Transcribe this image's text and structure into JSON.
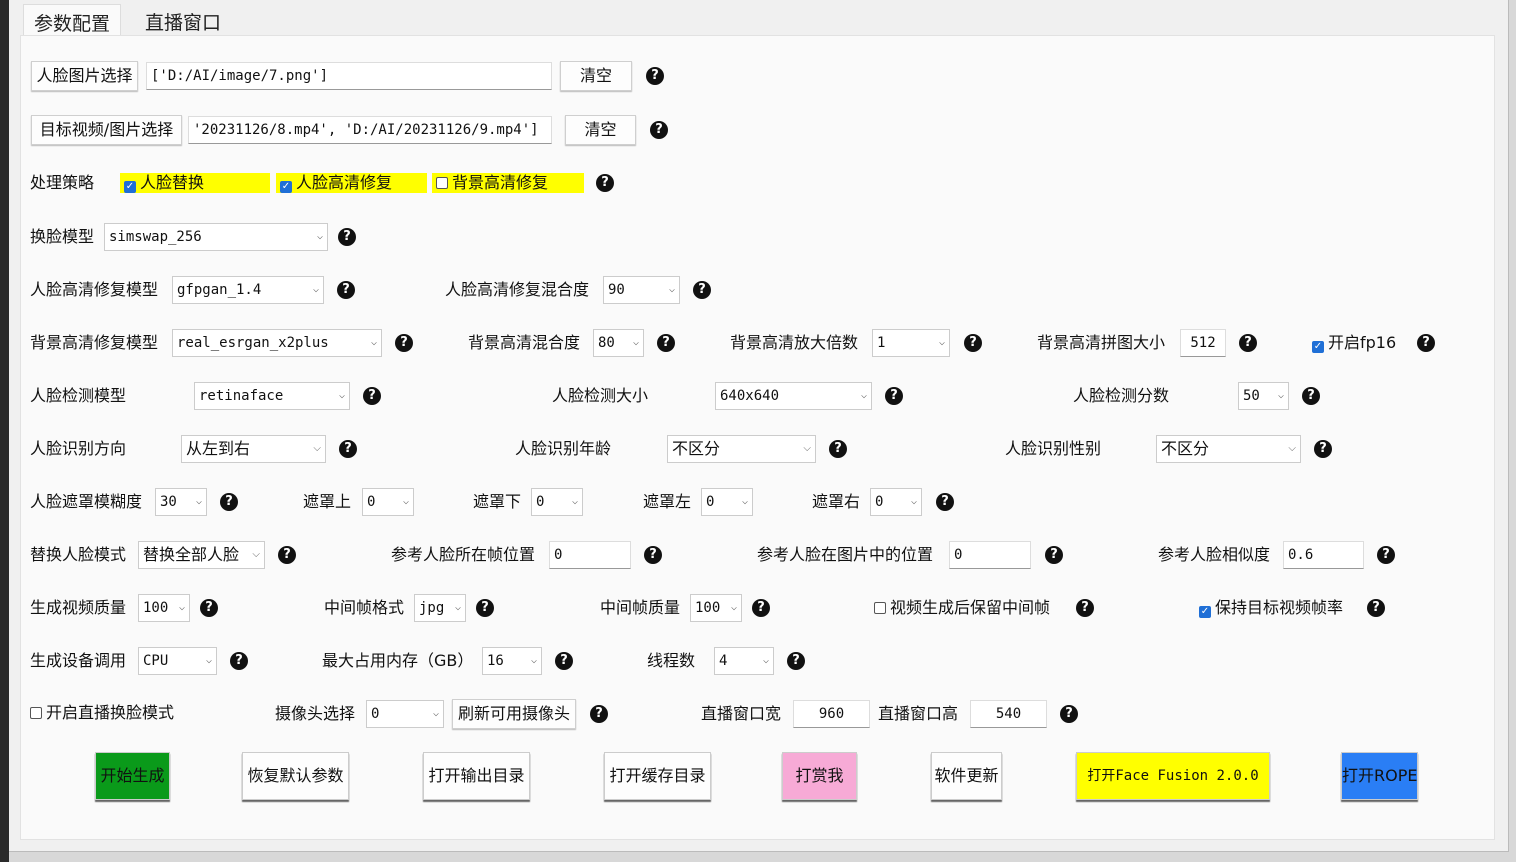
{
  "tabs": [
    {
      "label": "参数配置",
      "active": true
    },
    {
      "label": "直播窗口",
      "active": false
    }
  ],
  "face_image": {
    "button": "人脸图片选择",
    "value": "['D:/AI/image/7.png']",
    "clear": "清空"
  },
  "target": {
    "button": "目标视频/图片选择",
    "value": "'20231126/8.mp4', 'D:/AI/20231126/9.mp4']",
    "clear": "清空"
  },
  "strategy": {
    "label": "处理策略",
    "options": [
      {
        "label": "人脸替换",
        "checked": true
      },
      {
        "label": "人脸高清修复",
        "checked": true
      },
      {
        "label": "背景高清修复",
        "checked": false
      }
    ]
  },
  "swap_model": {
    "label": "换脸模型",
    "value": "simswap_256"
  },
  "face_enhance": {
    "label": "人脸高清修复模型",
    "value": "gfpgan_1.4",
    "blend_label": "人脸高清修复混合度",
    "blend": "90"
  },
  "bg_enhance": {
    "label": "背景高清修复模型",
    "value": "real_esrgan_x2plus",
    "blend_label": "背景高清混合度",
    "blend": "80",
    "scale_label": "背景高清放大倍数",
    "scale": "1",
    "tile_label": "背景高清拼图大小",
    "tile": "512",
    "fp16_label": "开启fp16",
    "fp16": true
  },
  "detect": {
    "model_label": "人脸检测模型",
    "model": "retinaface",
    "size_label": "人脸检测大小",
    "size": "640x640",
    "score_label": "人脸检测分数",
    "score": "50"
  },
  "recog": {
    "dir_label": "人脸识别方向",
    "dir": "从左到右",
    "age_label": "人脸识别年龄",
    "age": "不区分",
    "gender_label": "人脸识别性别",
    "gender": "不区分"
  },
  "mask": {
    "blur_label": "人脸遮罩模糊度",
    "blur": "30",
    "top_label": "遮罩上",
    "top": "0",
    "bottom_label": "遮罩下",
    "bottom": "0",
    "left_label": "遮罩左",
    "left": "0",
    "right_label": "遮罩右",
    "right": "0"
  },
  "ref": {
    "mode_label": "替换人脸模式",
    "mode": "替换全部人脸",
    "frame_label": "参考人脸所在帧位置",
    "frame": "0",
    "pos_label": "参考人脸在图片中的位置",
    "pos": "0",
    "sim_label": "参考人脸相似度",
    "sim": "0.6"
  },
  "output": {
    "quality_label": "生成视频质量",
    "quality": "100",
    "fmt_label": "中间帧格式",
    "fmt": "jpg",
    "fq_label": "中间帧质量",
    "fq": "100",
    "keep_label": "视频生成后保留中间帧",
    "keep": false,
    "fps_label": "保持目标视频帧率",
    "fps": true
  },
  "device": {
    "label": "生成设备调用",
    "value": "CPU",
    "mem_label": "最大占用内存（GB）",
    "mem": "16",
    "threads_label": "线程数",
    "threads": "4"
  },
  "live": {
    "mode_label": "开启直播换脸模式",
    "mode": false,
    "cam_label": "摄像头选择",
    "cam": "0",
    "refresh": "刷新可用摄像头",
    "w_label": "直播窗口宽",
    "w": "960",
    "h_label": "直播窗口高",
    "h": "540"
  },
  "help": "?",
  "actions": [
    {
      "label": "开始生成",
      "color": "#0a9a1a"
    },
    {
      "label": "恢复默认参数"
    },
    {
      "label": "打开输出目录"
    },
    {
      "label": "打开缓存目录"
    },
    {
      "label": "打赏我",
      "color": "#f7aad6"
    },
    {
      "label": "软件更新"
    },
    {
      "label": "打开Face Fusion 2.0.0",
      "color": "#ffff00"
    },
    {
      "label": "打开ROPE",
      "color": "#2a7ef5"
    }
  ]
}
